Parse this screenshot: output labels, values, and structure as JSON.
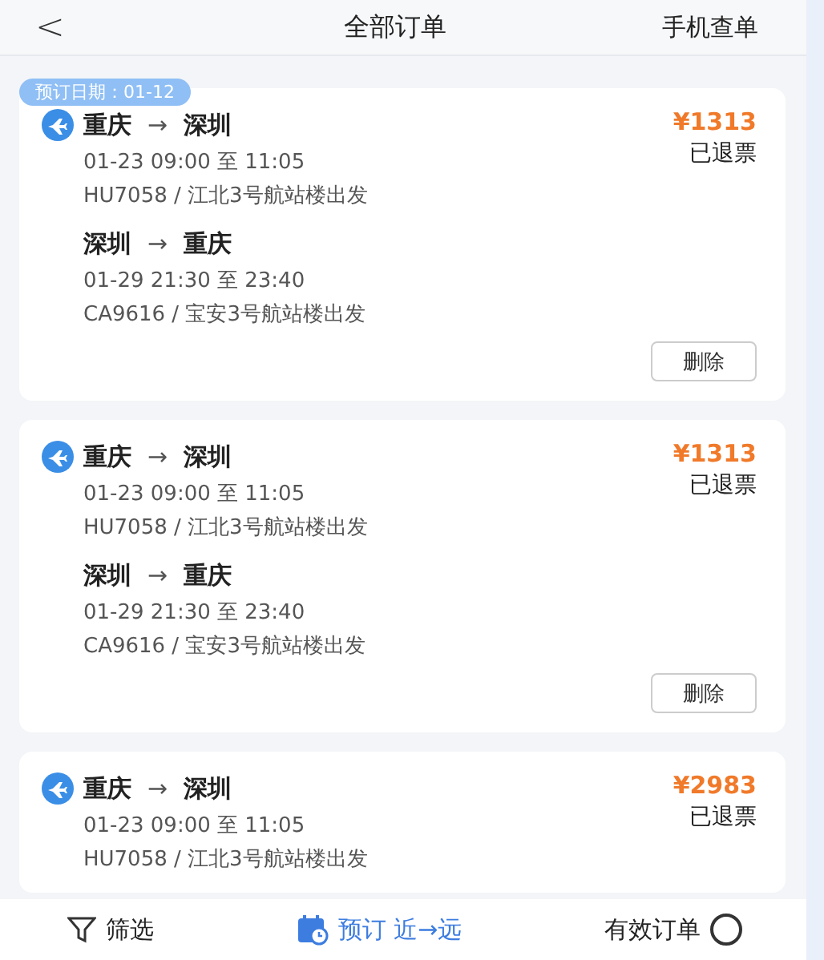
{
  "header": {
    "back": "<",
    "title": "全部订单",
    "action": "手机查单"
  },
  "orders": [
    {
      "booking_date": "预订日期：01-12",
      "price": "¥1313",
      "status": "已退票",
      "segments": [
        {
          "from": "重庆",
          "arrow": "→",
          "to": "深圳",
          "time": "01-23 09:00 至 11:05",
          "flight": "HU7058 / 江北3号航站楼出发"
        },
        {
          "from": "深圳",
          "arrow": "→",
          "to": "重庆",
          "time": "01-29 21:30 至 23:40",
          "flight": "CA9616 / 宝安3号航站楼出发"
        }
      ],
      "delete": "删除"
    },
    {
      "price": "¥1313",
      "status": "已退票",
      "segments": [
        {
          "from": "重庆",
          "arrow": "→",
          "to": "深圳",
          "time": "01-23 09:00 至 11:05",
          "flight": "HU7058 / 江北3号航站楼出发"
        },
        {
          "from": "深圳",
          "arrow": "→",
          "to": "重庆",
          "time": "01-29 21:30 至 23:40",
          "flight": "CA9616 / 宝安3号航站楼出发"
        }
      ],
      "delete": "删除"
    },
    {
      "price": "¥2983",
      "status": "已退票",
      "segments": [
        {
          "from": "重庆",
          "arrow": "→",
          "to": "深圳",
          "time": "01-23 09:00 至 11:05",
          "flight": "HU7058 / 江北3号航站楼出发"
        }
      ]
    }
  ],
  "bottom_bar": {
    "filter": "筛选",
    "sort": "预订 近→远",
    "valid_only": {
      "label": "有效订单",
      "checked": false
    }
  }
}
